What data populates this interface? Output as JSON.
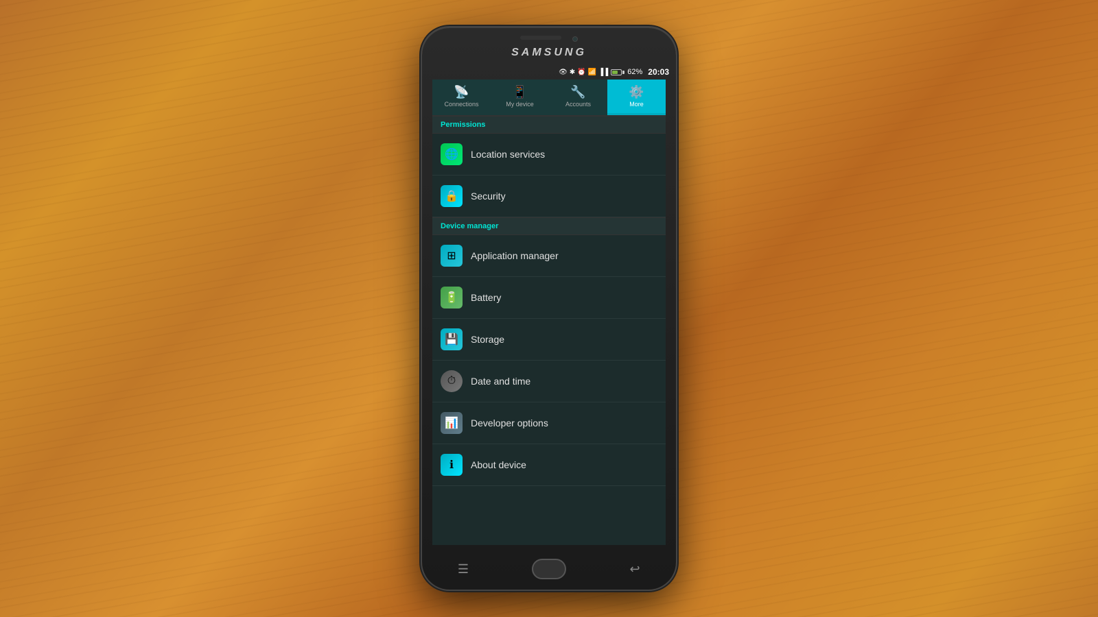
{
  "background": {
    "color": "#c8832a"
  },
  "phone": {
    "brand": "SAMSUNG",
    "status_bar": {
      "time": "20:03",
      "battery_percent": "62%",
      "icons": [
        "📡",
        "🔵",
        "⏰",
        "📶",
        "📶"
      ]
    },
    "tabs": [
      {
        "id": "connections",
        "label": "Connections",
        "icon": "📡",
        "active": false
      },
      {
        "id": "my-device",
        "label": "My device",
        "icon": "📱",
        "active": false
      },
      {
        "id": "accounts",
        "label": "Accounts",
        "icon": "🔧",
        "active": false
      },
      {
        "id": "more",
        "label": "More",
        "icon": "⚙️",
        "active": true
      }
    ],
    "sections": [
      {
        "id": "permissions",
        "header": "Permissions",
        "items": [
          {
            "id": "location-services",
            "label": "Location services",
            "icon_class": "icon-location",
            "icon": "🌐"
          },
          {
            "id": "security",
            "label": "Security",
            "icon_class": "icon-security",
            "icon": "🔒"
          }
        ]
      },
      {
        "id": "device-manager",
        "header": "Device manager",
        "items": [
          {
            "id": "application-manager",
            "label": "Application manager",
            "icon_class": "icon-app",
            "icon": "⊞"
          },
          {
            "id": "battery",
            "label": "Battery",
            "icon_class": "icon-battery",
            "icon": "🔋"
          },
          {
            "id": "storage",
            "label": "Storage",
            "icon_class": "icon-storage",
            "icon": "💾"
          },
          {
            "id": "date-and-time",
            "label": "Date and time",
            "icon_class": "icon-datetime",
            "icon": "⏰"
          },
          {
            "id": "developer-options",
            "label": "Developer options",
            "icon_class": "icon-developer",
            "icon": "📊"
          },
          {
            "id": "about-device",
            "label": "About device",
            "icon_class": "icon-about",
            "icon": "ℹ️"
          }
        ]
      }
    ],
    "bottom_buttons": {
      "menu": "☰",
      "back": "↩"
    }
  }
}
